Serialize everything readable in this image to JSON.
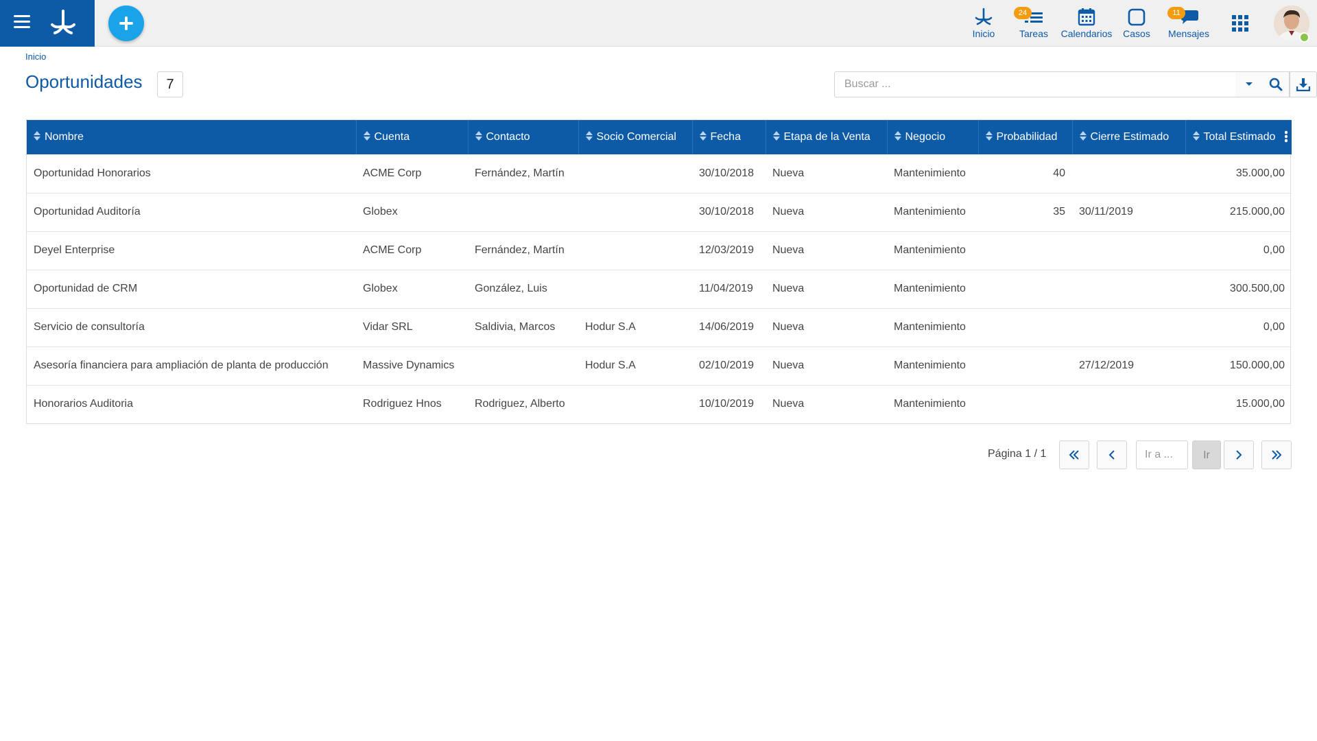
{
  "topbar": {
    "nav": [
      {
        "label": "Inicio",
        "icon": "deyel-logo-icon"
      },
      {
        "label": "Tareas",
        "icon": "tasks-icon",
        "badge": "24"
      },
      {
        "label": "Calendarios",
        "icon": "calendar-icon"
      },
      {
        "label": "Casos",
        "icon": "cases-icon"
      },
      {
        "label": "Mensajes",
        "icon": "messages-icon",
        "badge": "11"
      }
    ]
  },
  "breadcrumb": "Inicio",
  "page": {
    "title": "Oportunidades",
    "count": "7"
  },
  "search": {
    "placeholder": "Buscar ..."
  },
  "table": {
    "columns": [
      "Nombre",
      "Cuenta",
      "Contacto",
      "Socio Comercial",
      "Fecha",
      "Etapa de la Venta",
      "Negocio",
      "Probabilidad",
      "Cierre Estimado",
      "Total Estimado"
    ],
    "rows": [
      [
        "Oportunidad Honorarios",
        "ACME Corp",
        "Fernández, Martín",
        "",
        "30/10/2018",
        "Nueva",
        "Mantenimiento",
        "40",
        "",
        "35.000,00"
      ],
      [
        "Oportunidad Auditoría",
        "Globex",
        "",
        "",
        "30/10/2018",
        "Nueva",
        "Mantenimiento",
        "35",
        "30/11/2019",
        "215.000,00"
      ],
      [
        "Deyel Enterprise",
        "ACME Corp",
        "Fernández, Martín",
        "",
        "12/03/2019",
        "Nueva",
        "Mantenimiento",
        "",
        "",
        "0,00"
      ],
      [
        "Oportunidad de CRM",
        "Globex",
        "González, Luis",
        "",
        "11/04/2019",
        "Nueva",
        "Mantenimiento",
        "",
        "",
        "300.500,00"
      ],
      [
        "Servicio de consultoría",
        "Vidar SRL",
        "Saldivia, Marcos",
        "Hodur S.A",
        "14/06/2019",
        "Nueva",
        "Mantenimiento",
        "",
        "",
        "0,00"
      ],
      [
        "Asesoría financiera para ampliación de planta de producción",
        "Massive Dynamics",
        "",
        "Hodur S.A",
        "02/10/2019",
        "Nueva",
        "Mantenimiento",
        "",
        "27/12/2019",
        "150.000,00"
      ],
      [
        "Honorarios Auditoria",
        "Rodriguez Hnos",
        "Rodriguez, Alberto",
        "",
        "10/10/2019",
        "Nueva",
        "Mantenimiento",
        "",
        "",
        "15.000,00"
      ]
    ]
  },
  "pagination": {
    "label": "Página 1 / 1",
    "goto_placeholder": "Ir a ...",
    "go_label": "Ir"
  },
  "colors": {
    "primary": "#0d5aa7",
    "accent": "#1aa3e8",
    "badge": "#f39c12",
    "online": "#8bc34a"
  }
}
